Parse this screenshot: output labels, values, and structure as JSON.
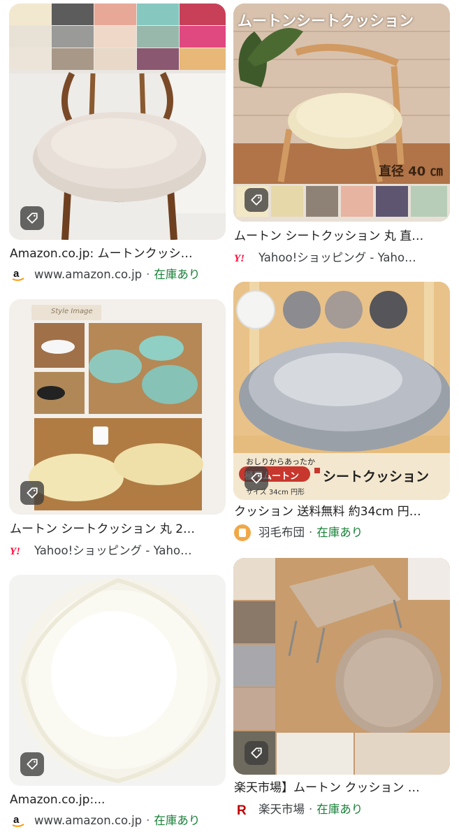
{
  "results": [
    {
      "title": "Amazon.co.jp: ムートンクッシ…",
      "source": "www.amazon.co.jp",
      "stock": "在庫あり",
      "icon": "amazon-logo-icon"
    },
    {
      "title": "ムートン シートクッション 丸 直…",
      "source": "Yahoo!ショッピング - Yaho…",
      "stock": "",
      "icon": "yahoo-logo-icon",
      "overlay_title": "ムートンシートクッション",
      "overlay_size": "直径 40 ㎝"
    },
    {
      "title": "ムートン シートクッション 丸 2…",
      "source": "Yahoo!ショッピング - Yaho…",
      "stock": "",
      "icon": "yahoo-logo-icon",
      "overlay_label": "Style Image"
    },
    {
      "title": "クッション 送料無料 約34cm 円…",
      "source": "羽毛布団",
      "stock": "在庫あり",
      "icon": "store-logo-icon",
      "overlay_caption": "おしりからあったか",
      "overlay_banner_red": "極厚ムートン",
      "overlay_banner": "シートクッション",
      "overlay_size": "サイズ 34cm 円形"
    },
    {
      "title": "Amazon.co.jp:...",
      "source": "www.amazon.co.jp",
      "stock": "在庫あり",
      "icon": "amazon-logo-icon"
    },
    {
      "title": "楽天市場】ムートン クッション …",
      "source": "楽天市場",
      "stock": "在庫あり",
      "icon": "rakuten-logo-icon"
    }
  ],
  "separator": "·",
  "colors": {
    "stock_green": "#188038",
    "yahoo_red": "#ff0033",
    "rakuten_red": "#bf0000",
    "amazon_orange": "#ff9900"
  }
}
